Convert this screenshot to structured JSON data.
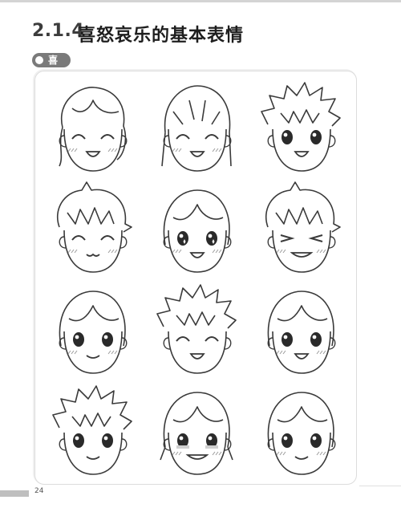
{
  "header": {
    "section_number": "2.1.4",
    "section_title": "喜怒哀乐的基本表情"
  },
  "tag": {
    "label": "喜"
  },
  "footer": {
    "page_number": "24"
  },
  "faces": [
    {
      "hair": "long-wavy",
      "eyes": "closed-happy",
      "mouth": "open",
      "blush": true
    },
    {
      "hair": "long-straight",
      "eyes": "closed-happy",
      "mouth": "open",
      "blush": true
    },
    {
      "hair": "spiky",
      "eyes": "open",
      "mouth": "open",
      "blush": false
    },
    {
      "hair": "messy",
      "eyes": "closed-happy",
      "mouth": "cat",
      "blush": true
    },
    {
      "hair": "bob",
      "eyes": "sparkle",
      "mouth": "open",
      "blush": true
    },
    {
      "hair": "messy",
      "eyes": "squint",
      "mouth": "grin",
      "blush": true
    },
    {
      "hair": "bob",
      "eyes": "open",
      "mouth": "smile",
      "blush": true
    },
    {
      "hair": "spiky",
      "eyes": "closed-happy",
      "mouth": "open",
      "blush": false
    },
    {
      "hair": "bob",
      "eyes": "open",
      "mouth": "open",
      "blush": true
    },
    {
      "hair": "spiky",
      "eyes": "open",
      "mouth": "smile",
      "blush": false
    },
    {
      "hair": "bob-pigtails",
      "eyes": "teary",
      "mouth": "grin",
      "blush": true
    },
    {
      "hair": "bob",
      "eyes": "open",
      "mouth": "smile",
      "blush": true
    }
  ]
}
